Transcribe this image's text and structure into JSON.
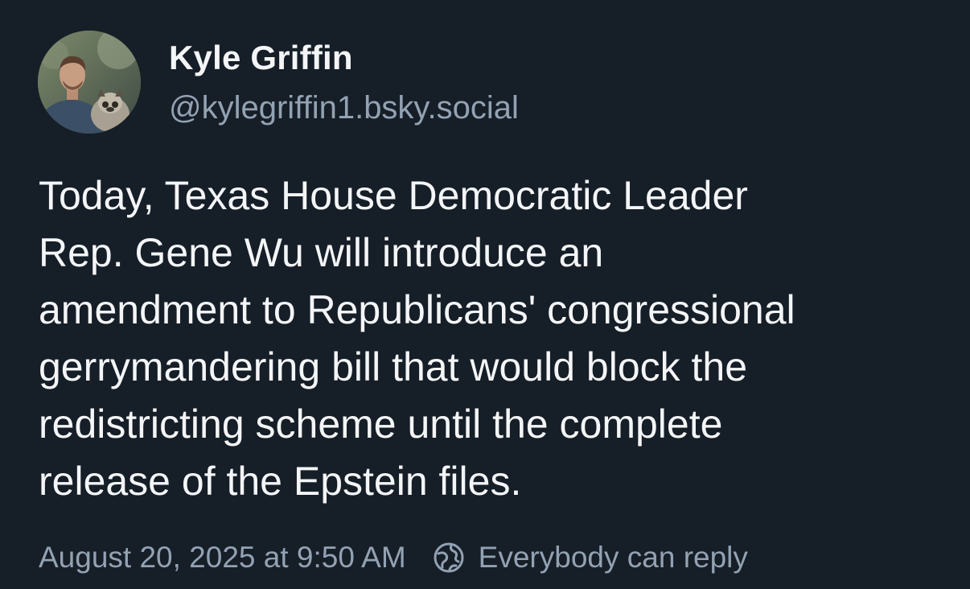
{
  "post": {
    "author": {
      "display_name": "Kyle Griffin",
      "handle": "@kylegriffin1.bsky.social",
      "avatar_icon": "user-avatar-photo"
    },
    "text": "Today, Texas House Democratic Leader\nRep. Gene Wu will introduce an\namendment to Republicans' congressional\ngerrymandering bill that would block the\nredistricting scheme until the complete\nrelease of the Epstein files.",
    "timestamp": "August 20, 2025 at 9:50 AM",
    "reply_setting": {
      "icon": "globe-icon",
      "label": "Everybody can reply"
    }
  },
  "colors": {
    "background": "#161e27",
    "primary_text": "#f3f5f7",
    "secondary_text": "#93a2b3"
  }
}
